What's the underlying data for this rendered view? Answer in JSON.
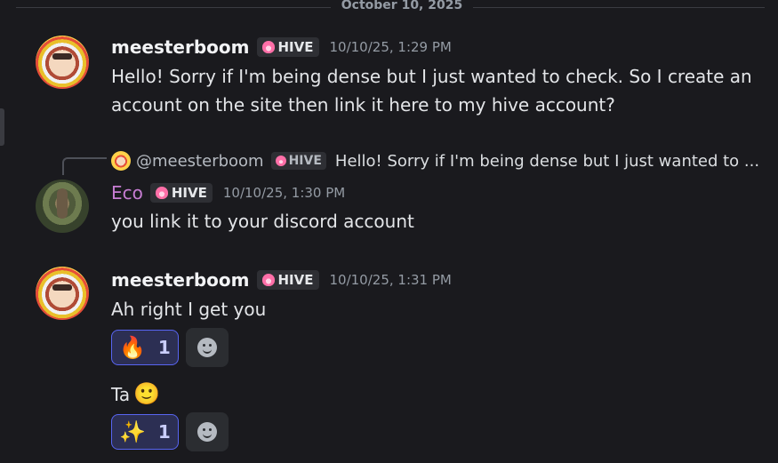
{
  "date_divider": "October 10, 2025",
  "messages": [
    {
      "author": "meesterboom",
      "tag": "HIVE",
      "timestamp": "10/10/25, 1:29 PM",
      "text": "Hello! Sorry if I'm being dense but I just wanted to check. So I create an account on the site then link it here to my hive account?"
    },
    {
      "reply": {
        "author": "@meesterboom",
        "tag": "HIVE",
        "preview": "Hello! Sorry if I'm being dense but I just wanted to ..."
      },
      "author": "Eco",
      "tag": "HIVE",
      "timestamp": "10/10/25, 1:30 PM",
      "text": "you link it to your discord account"
    },
    {
      "author": "meesterboom",
      "tag": "HIVE",
      "timestamp": "10/10/25, 1:31 PM",
      "text": "Ah right I get you",
      "reaction": {
        "emoji": "🔥",
        "count": "1"
      }
    },
    {
      "text": "Ta",
      "emoji": "🙂",
      "reaction": {
        "emoji": "✨",
        "count": "1"
      }
    }
  ],
  "icons": {
    "tag_icon": "hive-icon",
    "add_reaction_icon": "smiley-icon"
  },
  "colors": {
    "background": "#1a1a1e",
    "eco_name": "#c77dd3",
    "reaction_border": "#5865f2"
  }
}
